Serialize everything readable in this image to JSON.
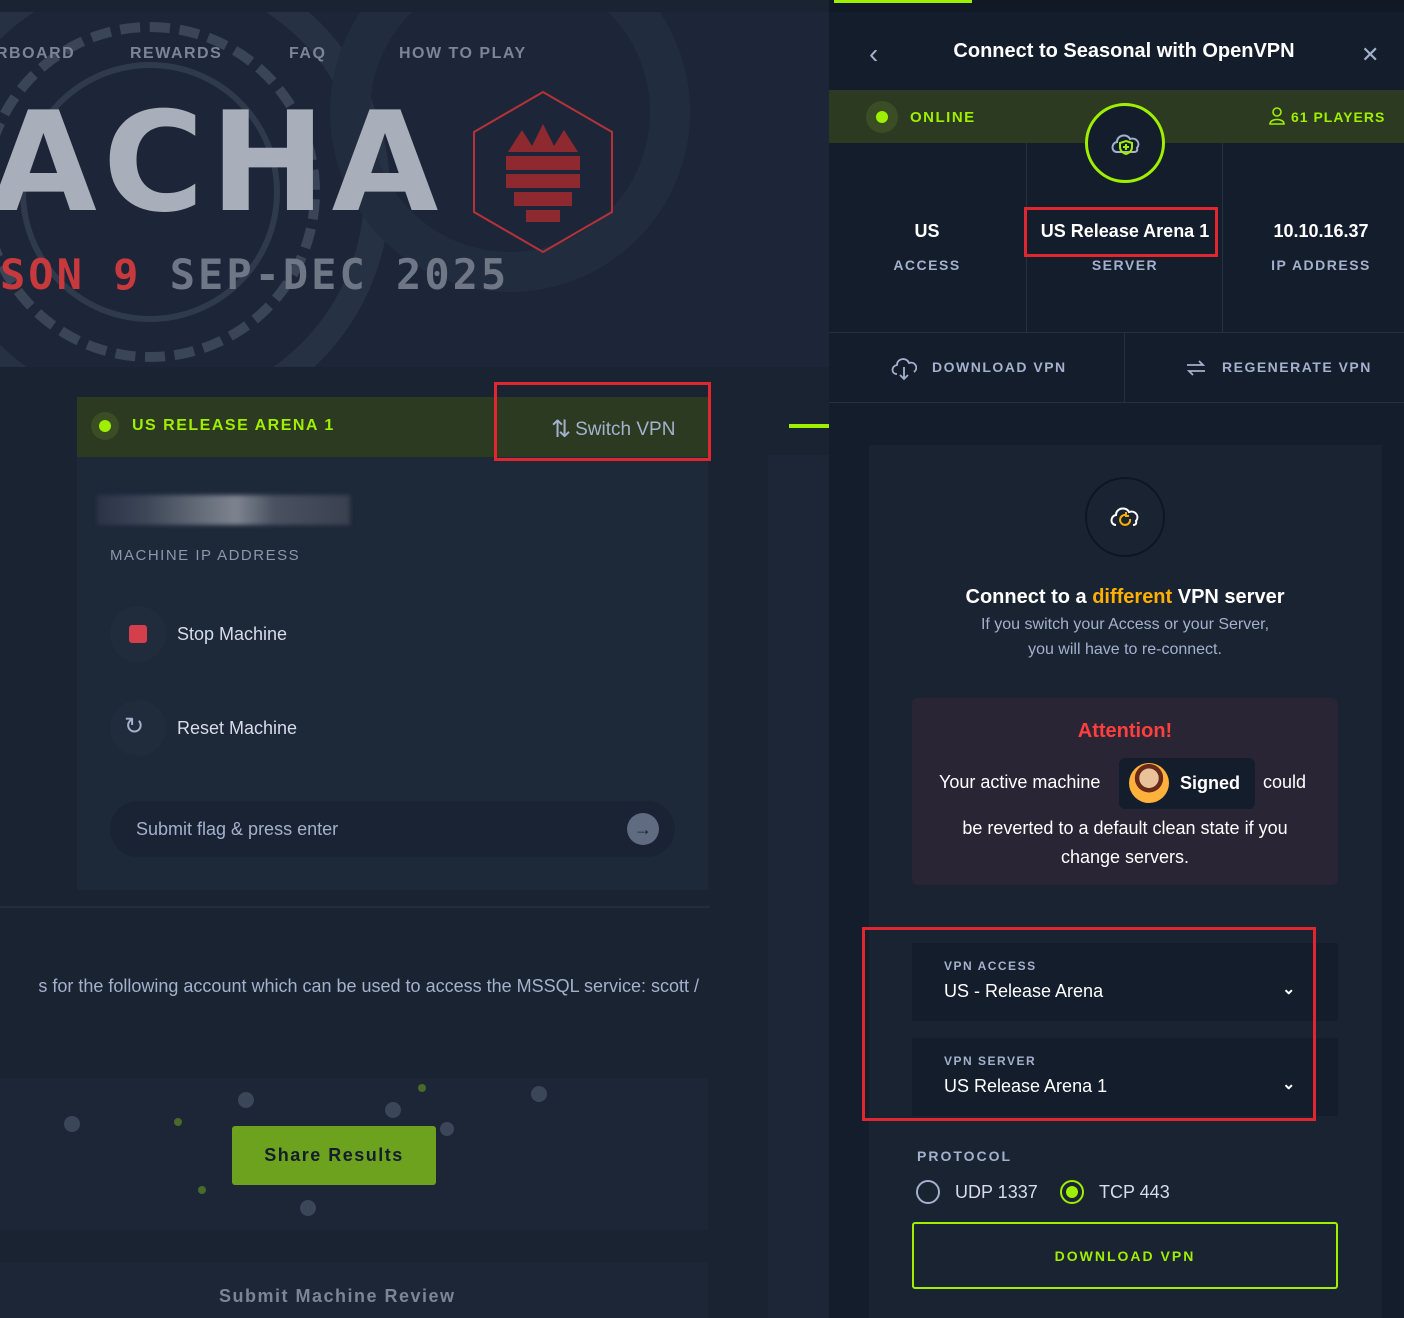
{
  "nav": {
    "items": [
      "RBOARD",
      "REWARDS",
      "FAQ",
      "HOW TO PLAY"
    ]
  },
  "hero": {
    "logo_text": "ACHA",
    "season_prefix": "SON",
    "season_number": "9",
    "season_dates": "SEP-DEC 2025"
  },
  "machine_panel": {
    "arena_label": "US RELEASE ARENA 1",
    "switch_vpn_label": "Switch VPN",
    "machine_ip_label": "MACHINE IP ADDRESS",
    "stop_label": "Stop Machine",
    "reset_label": "Reset Machine",
    "flag_placeholder": "Submit flag & press enter"
  },
  "description_fragment": "s for the following account which can be used to access the MSSQL service: scott /",
  "share_label": "Share Results",
  "review_label": "Submit Machine Review",
  "drawer": {
    "title": "Connect to Seasonal with OpenVPN",
    "status": "ONLINE",
    "players": "61 PLAYERS",
    "stats": [
      {
        "value": "US",
        "label": "ACCESS"
      },
      {
        "value": "US Release Arena 1",
        "label": "SERVER"
      },
      {
        "value": "10.10.16.37",
        "label": "IP ADDRESS"
      }
    ],
    "download_vpn": "DOWNLOAD VPN",
    "regenerate_vpn": "REGENERATE VPN",
    "card": {
      "title_before": "Connect to a ",
      "title_highlight": "different",
      "title_after": " VPN server",
      "subtitle_line1": "If you switch your Access or your Server,",
      "subtitle_line2": "you will have to re-connect.",
      "attention_heading": "Attention!",
      "attention_before": "Your active machine",
      "machine_name": "Signed",
      "attention_after": "could",
      "attention_line2": "be reverted to a default clean state if you",
      "attention_line3": "change servers.",
      "vpn_access_label": "VPN ACCESS",
      "vpn_access_value": "US - Release Arena",
      "vpn_server_label": "VPN SERVER",
      "vpn_server_value": "US Release Arena 1",
      "protocol_label": "PROTOCOL",
      "protocol_options": [
        "UDP 1337",
        "TCP 443"
      ],
      "protocol_selected": "TCP 443",
      "download_button": "DOWNLOAD VPN"
    }
  },
  "colors": {
    "accent_green": "#9fef00",
    "highlight_orange": "#ffaf00",
    "attention_red": "#ff3e3e",
    "annotation_red": "#e0262e",
    "background": "#141d2b"
  },
  "icons": [
    "back-chevron-icon",
    "close-icon",
    "status-dot-icon",
    "user-icon",
    "cloud-shield-icon",
    "cloud-download-icon",
    "regenerate-icon",
    "cloud-refresh-icon",
    "switch-arrows-icon",
    "stop-icon",
    "reset-icon",
    "arrow-right-icon",
    "chevron-down-icon"
  ]
}
